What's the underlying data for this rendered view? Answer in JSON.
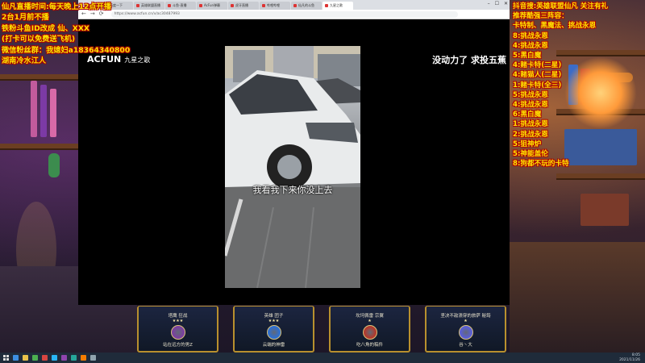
{
  "overlay_left": {
    "lines": [
      "仙凡直播时间:每天晚上12点开播",
      "2台1月前不播",
      "铁粉斗鱼ID改成 仙、XXX",
      "(打卡可以免费送飞机)",
      "微信粉丝群：我媳妇a18364340800",
      "湖南冷水江人"
    ]
  },
  "overlay_right": {
    "lines": [
      "抖音搜:英雄联盟仙凡 关注有礼",
      "推荐酷强三阵容：",
      "卡特制、黑魔法、挑战永恩",
      "8:挑战永恩",
      "4:挑战永恩",
      "5:黑白魔",
      "4:赌卡特(二星)",
      "4:赌猫人(二星)",
      "1:赌卡特(全三)",
      "5:挑战永恩",
      "4:挑战永恩",
      "6:黑白魔",
      "1:挑战永恩",
      "2:挑战永恩",
      "5:狙神炉",
      "5:神能盖伦",
      "8:狗都不玩的卡特"
    ]
  },
  "browser": {
    "tabs": [
      "百度一下",
      "英雄联盟直播",
      "斗鱼-直播",
      "AcFun弹幕",
      "虎牙直播",
      "哔哩哔哩",
      "仙凡的斗鱼",
      "九星之歌"
    ],
    "url": "https://www.acfun.cn/v/ac30487993",
    "nav": {
      "back": "←",
      "forward": "→",
      "reload": "⟳"
    },
    "window_controls": [
      "–",
      "☐",
      "✕"
    ]
  },
  "video": {
    "logo": "ACFUN",
    "logo_sub": "九星之歌",
    "top_caption": "没动力了 求投五蕉",
    "subtitle": "我看我下来你没上去"
  },
  "cards": [
    {
      "title": "塔鹰 狂战",
      "stars": "★★★",
      "name": "站在远方的男Z",
      "color": "#7b3fa0"
    },
    {
      "title": "英雄 团子",
      "stars": "★★★",
      "name": "云端的神雷",
      "color": "#2e6fd1"
    },
    {
      "title": "坎坷佩雷 宗翼",
      "stars": "★",
      "name": "吃八角的稿件",
      "color": "#b3392c"
    },
    {
      "title": "坚决不敌溃穿的旅萨 秘筠",
      "stars": "★",
      "name": "谷丶大",
      "color": "#5a5fd6"
    }
  ],
  "taskbar": {
    "time": "8:05",
    "date": "2021/11/26"
  }
}
